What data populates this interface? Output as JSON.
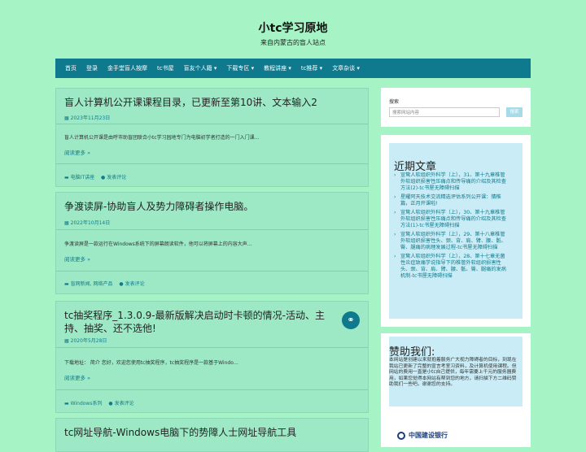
{
  "site": {
    "title": "小tc学习原地",
    "description": "来自内蒙古的盲人站点"
  },
  "nav": [
    "首页",
    "登录",
    "金手堂盲人按摩",
    "tc书屋",
    "盲友个人籍 ▾",
    "下载专区 ▾",
    "教程讲座 ▾",
    "tc推荐 ▾",
    "文章杂谈 ▾"
  ],
  "posts": [
    {
      "title": "盲人计算机公开课课程目录，已更新至第10讲、文本输入2",
      "date": "2023年11月23日",
      "excerpt": "盲人计算机公开课是由呼市助盲团联合小tc学习园地专门为电脑初学者打造的一门入门课…",
      "read_more": "阅读更多 »",
      "category": "电脑IT讲座",
      "comment": "发表评论"
    },
    {
      "title": "争渡读屏-协助盲人及势力障碍者操作电脑。",
      "date": "2022年10月14日",
      "excerpt": "争渡读屏是一款运行在Windows系统下的屏幕朗读软件，他可以将屏幕上的内容大声…",
      "read_more": "阅读更多 »",
      "category": "盲网新闻, 网络产品",
      "comment": "发表评论"
    },
    {
      "title": "tc抽奖程序_1.3.0.9-最新版解决启动时卡顿的情况-活动、主持、抽奖、还不选他!",
      "date": "2020年5月28日",
      "excerpt": "下载地址： 简介 您好，欢迎您使用tc抽奖程序，tc抽奖程序是一款基于Windo…",
      "read_more": "阅读更多 »",
      "category": "Windows系列",
      "comment": "发表评论"
    },
    {
      "title": "tc网址导航-Windows电脑下的势障人士网址导航工具"
    }
  ],
  "sidebar": {
    "search_label": "搜索",
    "search_placeholder": "搜索网站内容",
    "search_button": "搜索",
    "recent_title": "近期文章",
    "recent": [
      "宣鸷人软组织外科学（上），31、第十九章椎管外软组织损害性压痛点和传导痛的介绍及其检查方法(2)-tc书屋无障碍扫描",
      "星耀阿天技术交流精选评估系列公开课：猜椎篇，正月开课啦!",
      "宣鸷人软组织外科学（上），30、第十九章椎管外软组织损害性压痛点和传导痛的介绍及其检查方法(1)-tc书屋无障碍扫描",
      "宣鸷人软组织外科学（上），29、第十八章椎管外软组织损害性头、颈、背、肩、臂、腰、骶、臀、腿痛的病理发展过程-tc书屋无障碍扫描",
      "宣鸷人软组织外科学（上），28、第十七章无菌性炎症致痛学说指导下的椎管外软组织损害性头、颈、背、肩、臂、腰、骶、臀、腿痛的发病机制-tc书屋无障碍扫描"
    ],
    "donate_title": "赞助我们:",
    "donate_text": "本网站是创建以来就抱着服务广大视力障碍者的目标，到现在我站已更新了完整的宣言考室习资料，及计算机使用课程。但网站的费用一直是小tc自己提供，每年需要上千元的服务器费用，如果您觉得本网站有帮到您的地方，请扫描下方二维码赞助我们一些吧。谢谢您的支持。",
    "bank": "中国建设银行"
  }
}
